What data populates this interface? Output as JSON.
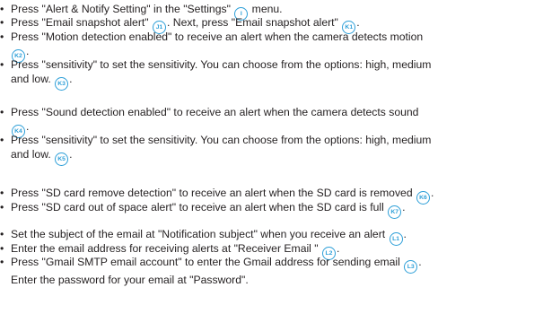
{
  "bullet": "•",
  "items": [
    {
      "a": "Press \"Alert & Notify Setting\" in the \"Settings\" ",
      "b1": "I",
      "b": " menu."
    },
    {
      "a": "Press \"Email snapshot alert\" ",
      "b1": "J1",
      "b": ". Next, press \"Email snapshot alert\" ",
      "b2": "K1",
      "c": "."
    },
    {
      "a": "Press \"Motion detection enabled\" to receive an alert when the camera detects motion",
      "b1": "K2",
      "b": "."
    },
    {
      "a": "Press \"sensitivity\" to set the sensitivity. You can choose from the options: high, medium",
      "a2": "and low. ",
      "b1": "K3",
      "b": "."
    },
    {
      "a": "Press \"Sound detection enabled\" to receive an alert when the camera detects sound",
      "b1": "K4",
      "b": "."
    },
    {
      "a": "Press \"sensitivity\" to set the sensitivity. You can choose from the options: high, medium",
      "a2": "and low. ",
      "b1": "K5",
      "b": "."
    },
    {
      "a": "Press \"SD card remove detection\" to receive an alert when the SD card is removed ",
      "b1": "K6",
      "b": "."
    },
    {
      "a": "Press \"SD card out of space alert\" to receive an alert when the SD card is full ",
      "b1": "K7",
      "b": "."
    },
    {
      "a": "Set the subject of the email at \"Notification subject\" when you receive an alert ",
      "b1": "L1",
      "b": "."
    },
    {
      "a": "Enter the email address for receiving alerts at \"Receiver Email \" ",
      "b1": "L2",
      "b": "."
    },
    {
      "a": "Press \"Gmail SMTP email account\" to enter the Gmail address for sending email ",
      "b1": "L3",
      "b": ".",
      "a2": "Enter the password for your email at \"Password\"."
    }
  ]
}
